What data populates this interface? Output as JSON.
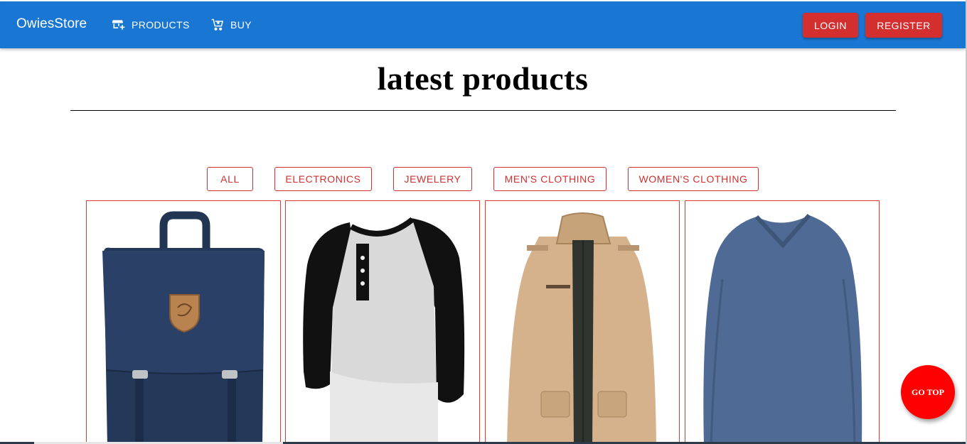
{
  "header": {
    "brand": "OwiesStore",
    "nav": [
      {
        "label": "PRODUCTS",
        "icon": "store-add-icon"
      },
      {
        "label": "BUY",
        "icon": "cart-add-icon"
      }
    ],
    "login_label": "LOGIN",
    "register_label": "REGISTER",
    "colors": {
      "bar": "#1976d2",
      "auth_button": "#d32f2f"
    }
  },
  "main": {
    "title": "latest products",
    "filters": [
      "ALL",
      "ELECTRONICS",
      "JEWELERY",
      "MEN'S CLOTHING",
      "WOMEN'S CLOTHING"
    ],
    "filter_color": "#d32f2f",
    "products": [
      {
        "image": "navy-backpack-image"
      },
      {
        "image": "raglan-henley-shirt-image"
      },
      {
        "image": "khaki-cotton-jacket-image"
      },
      {
        "image": "blue-vneck-longsleeve-image"
      }
    ]
  },
  "go_top_label": "GO TOP",
  "go_top_color": "#ff0000"
}
